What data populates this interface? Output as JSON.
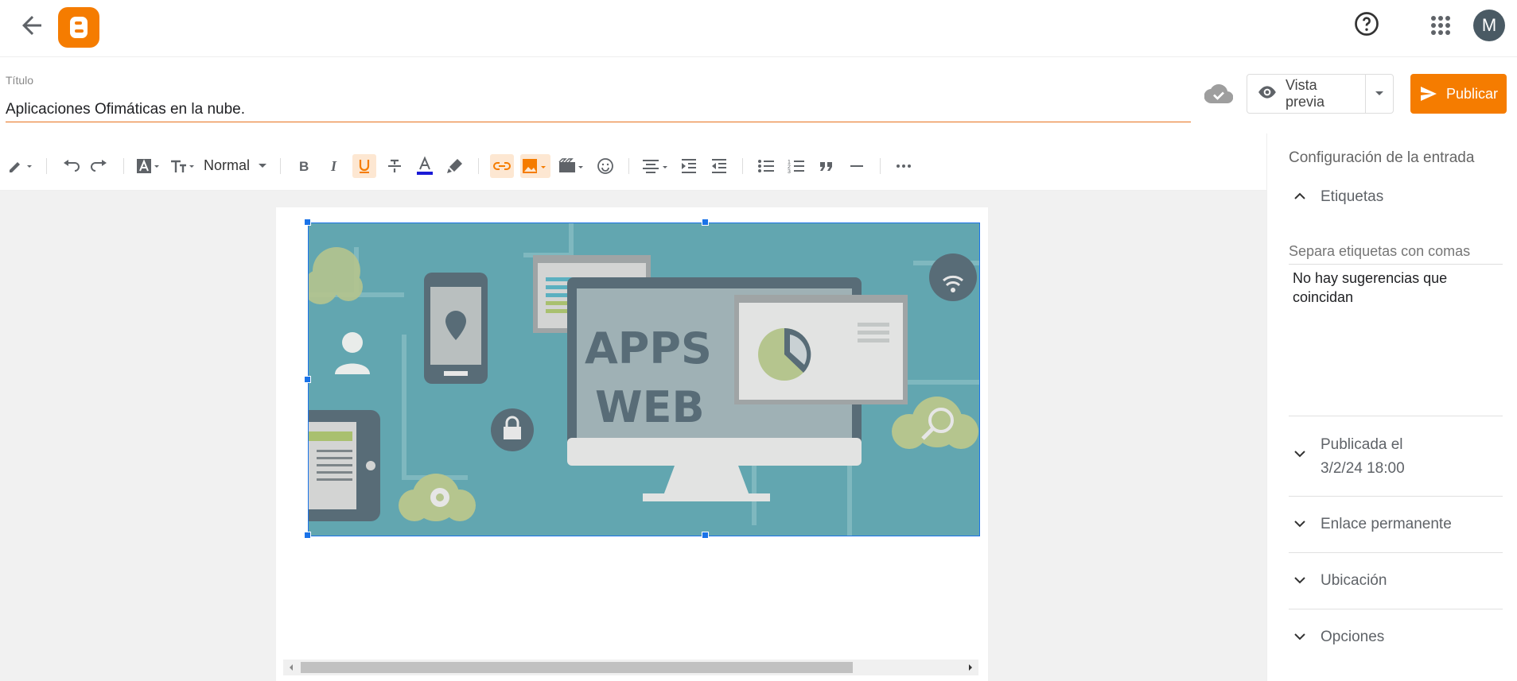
{
  "topbar": {
    "back_icon": "arrow-back-icon",
    "logo": "blogger-logo",
    "help_icon": "help-icon",
    "apps_icon": "apps-grid-icon",
    "avatar_initial": "M"
  },
  "post": {
    "title_label": "Título",
    "title_value": "Aplicaciones Ofimáticas en la nube."
  },
  "actions": {
    "preview_label": "Vista previa",
    "publish_label": "Publicar"
  },
  "toolbar": {
    "format_label": "Normal"
  },
  "image": {
    "line1": "APPS",
    "line2": "WEB"
  },
  "sidebar": {
    "title": "Configuración de la entrada",
    "labels_header": "Etiquetas",
    "labels_placeholder": "Separa etiquetas con comas",
    "no_suggestions": "No hay sugerencias que coincidan",
    "published_label": "Publicada el",
    "published_date": "3/2/24 18:00",
    "permalink": "Enlace permanente",
    "location": "Ubicación",
    "options": "Opciones"
  },
  "colors": {
    "accent": "#f57c00",
    "selection": "#1a73e8"
  }
}
